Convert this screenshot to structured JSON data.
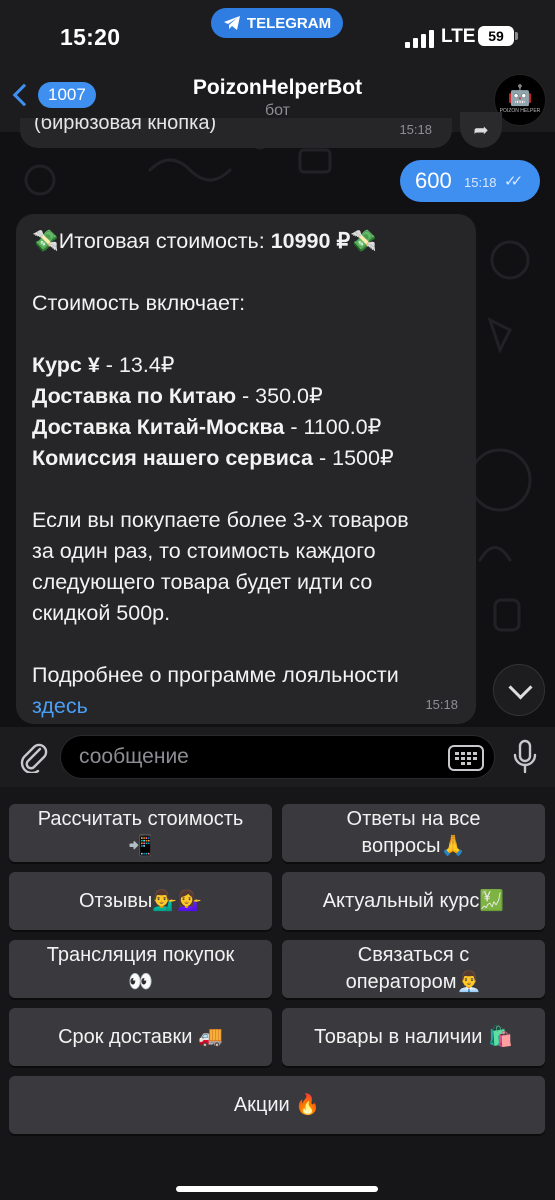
{
  "status_bar": {
    "time": "15:20",
    "app_pill": "TELEGRAM",
    "network": "LTE",
    "battery": "59"
  },
  "header": {
    "back_count": "1007",
    "title": "PoizonHelperBot",
    "subtitle": "бот",
    "avatar_caption": "POIZON HELPER"
  },
  "messages": {
    "previous": {
      "text": "(бирюзовая кнопка)",
      "time": "15:18"
    },
    "outgoing": {
      "text": "600",
      "time": "15:18"
    },
    "reply": {
      "emoji": "💸",
      "total_label": "Итоговая стоимость: ",
      "total_value": "10990 ₽",
      "includes": "Стоимость включает:",
      "rows": [
        {
          "label": "Курс ¥",
          "value": " - 13.4₽"
        },
        {
          "label": "Доставка по Китаю",
          "value": " - 350.0₽"
        },
        {
          "label": "Доставка Китай-Москва",
          "value": " - 1100.0₽"
        },
        {
          "label": "Комиссия нашего сервиса",
          "value": " - 1500₽"
        }
      ],
      "note_lines": [
        "Если вы покупаете более 3-х товаров",
        "за один раз, то стоимость каждого",
        "следующего товара будет идти со",
        "скидкой 500р."
      ],
      "loyalty_text": "Подробнее о программе лояльности",
      "loyalty_link": "здесь",
      "time": "15:18"
    }
  },
  "input": {
    "placeholder": "сообщение"
  },
  "keyboard": {
    "buttons": [
      {
        "line1": "Рассчитать стоимость",
        "line2": "📲"
      },
      {
        "line1": "Ответы на все",
        "line2": "вопросы🙏"
      },
      {
        "line1": "Отзывы💁‍♂️💁‍♀️",
        "line2": ""
      },
      {
        "line1": "Актуальный курс💹",
        "line2": ""
      },
      {
        "line1": "Трансляция покупок",
        "line2": "👀"
      },
      {
        "line1": "Связаться с",
        "line2": "оператором👨‍💼"
      },
      {
        "line1": "Срок доставки 🚚",
        "line2": ""
      },
      {
        "line1": "Товары в наличии 🛍️",
        "line2": ""
      },
      {
        "line1": "Акции 🔥",
        "line2": ""
      }
    ]
  }
}
